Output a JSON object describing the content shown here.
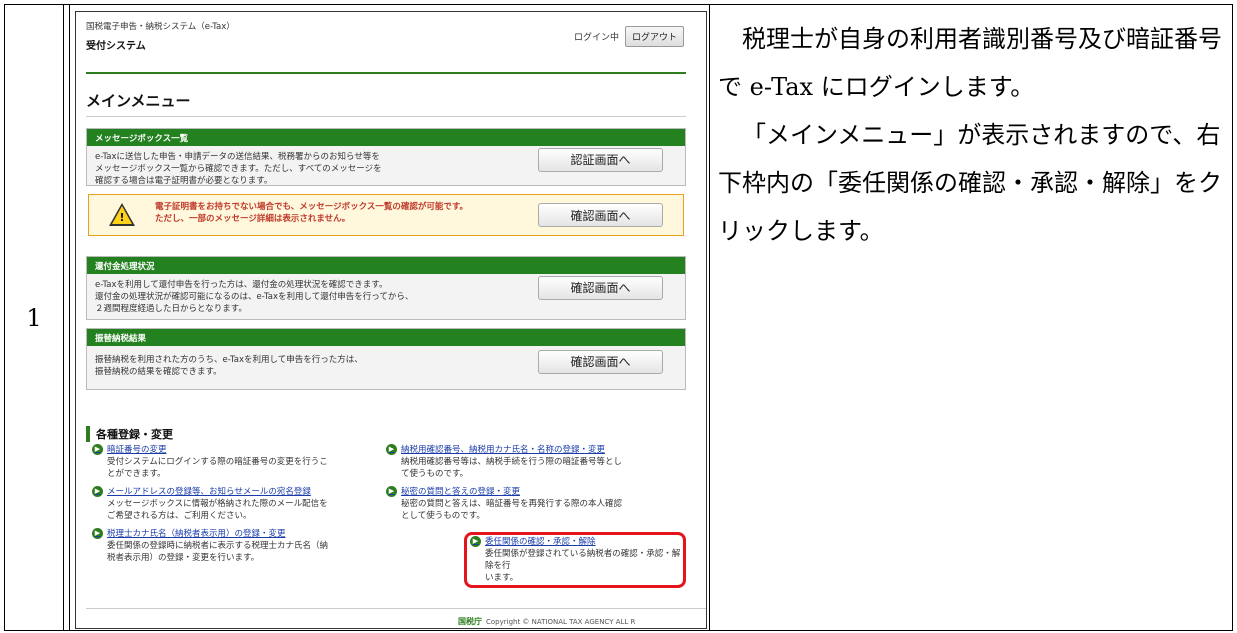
{
  "doc": {
    "row_number": "1",
    "instructions": [
      "税理士が自身の利用者識別番号及び暗証番号で e-Tax にログインします。",
      "「メインメニュー」が表示されますので、右下枠内の「委任関係の確認・承認・解除」をクリックします。"
    ]
  },
  "screen": {
    "system_name": "国税電子申告・納税システム（e-Tax）",
    "subsystem": "受付システム",
    "login_status": "ログイン中",
    "logout_label": "ログアウト",
    "page_title": "メインメニュー",
    "sections": [
      {
        "header": "メッセージボックス一覧",
        "body": [
          "e-Taxに送信した申告・申請データの送信結果、税務署からのお知らせ等を",
          "メッセージボックス一覧から確認できます。ただし、すべてのメッセージを",
          "確認する場合は電子証明書が必要となります。"
        ],
        "button": "認証画面へ"
      },
      {
        "header": "還付金処理状況",
        "body": [
          "e-Taxを利用して還付申告を行った方は、還付金の処理状況を確認できます。",
          "還付金の処理状況が確認可能になるのは、e-Taxを利用して還付申告を行ってから、",
          "２週間程度経過した日からとなります。"
        ],
        "button": "確認画面へ"
      },
      {
        "header": "振替納税結果",
        "body": [
          "振替納税を利用された方のうち、e-Taxを利用して申告を行った方は、",
          "振替納税の結果を確認できます。"
        ],
        "button": "確認画面へ"
      }
    ],
    "warning": {
      "lines": [
        "電子証明書をお持ちでない場合でも、メッセージボックス一覧の確認が可能です。",
        "ただし、一部のメッセージ詳細は表示されません。"
      ],
      "button": "確認画面へ"
    },
    "registration": {
      "heading": "各種登録・変更",
      "items": [
        {
          "link": "暗証番号の変更",
          "desc": [
            "受付システムにログインする際の暗証番号の変更を行うこ",
            "とができます。"
          ]
        },
        {
          "link": "納税用確認番号、納税用カナ氏名・名称の登録・変更",
          "desc": [
            "納税用確認番号等は、納税手続を行う際の暗証番号等とし",
            "て使うものです。"
          ]
        },
        {
          "link": "メールアドレスの登録等、お知らせメールの宛名登録",
          "desc": [
            "メッセージボックスに情報が格納された際のメール配信を",
            "ご希望される方は、ご利用ください。"
          ]
        },
        {
          "link": "秘密の質問と答えの登録・変更",
          "desc": [
            "秘密の質問と答えは、暗証番号を再発行する際の本人確認",
            "として使うものです。"
          ]
        },
        {
          "link": "税理士カナ氏名（納税者表示用）の登録・変更",
          "desc": [
            "委任関係の登録時に納税者に表示する税理士カナ氏名（納",
            "税者表示用）の登録・変更を行います。"
          ]
        },
        {
          "link": "委任関係の確認・承認・解除",
          "desc": [
            "委任関係が登録されている納税者の確認・承認・解除を行",
            "います。"
          ]
        }
      ]
    },
    "footer": {
      "agency": "国税庁",
      "copyright": "Copyright © NATIONAL TAX AGENCY ALL R"
    }
  },
  "colors": {
    "green": "#238120",
    "highlight_red": "#e4141c",
    "link_blue": "#1a3caa"
  }
}
